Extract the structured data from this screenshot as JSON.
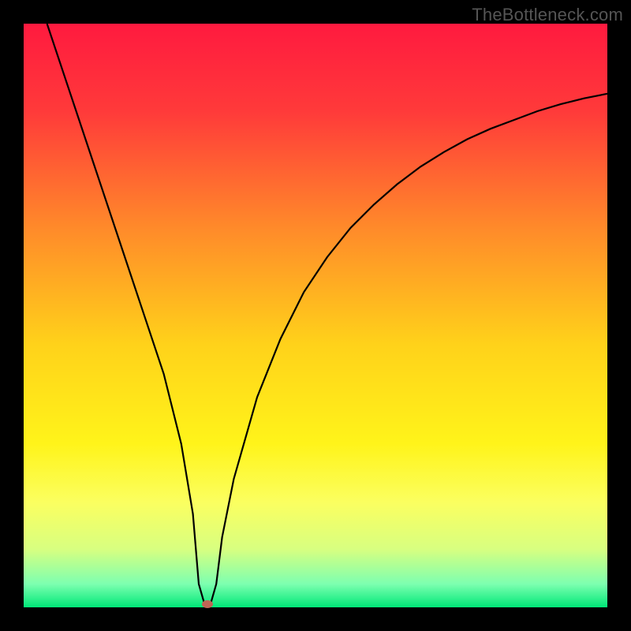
{
  "watermark": "TheBottleneck.com",
  "chart_data": {
    "type": "line",
    "title": "",
    "xlabel": "",
    "ylabel": "",
    "xlim": [
      0,
      100
    ],
    "ylim": [
      0,
      100
    ],
    "grid": false,
    "legend": false,
    "series": [
      {
        "name": "bottleneck-curve",
        "color": "#000000",
        "x": [
          4,
          8,
          12,
          16,
          20,
          24,
          27,
          29,
          30,
          31,
          32,
          33,
          34,
          36,
          40,
          44,
          48,
          52,
          56,
          60,
          64,
          68,
          72,
          76,
          80,
          84,
          88,
          92,
          96,
          100
        ],
        "y": [
          100,
          88,
          76,
          64,
          52,
          40,
          28,
          16,
          4,
          0.5,
          0.5,
          4,
          12,
          22,
          36,
          46,
          54,
          60,
          65,
          69,
          72.5,
          75.5,
          78,
          80.2,
          82,
          83.5,
          85,
          86.2,
          87.2,
          88
        ]
      }
    ],
    "marker": {
      "x": 31.5,
      "y": 0.5,
      "color": "#c06555"
    },
    "background_gradient": {
      "type": "vertical",
      "stops": [
        {
          "pos": 0.0,
          "color": "#ff1a3f"
        },
        {
          "pos": 0.15,
          "color": "#ff3a3a"
        },
        {
          "pos": 0.35,
          "color": "#ff8a2a"
        },
        {
          "pos": 0.55,
          "color": "#ffd21a"
        },
        {
          "pos": 0.72,
          "color": "#fff41a"
        },
        {
          "pos": 0.82,
          "color": "#fbff60"
        },
        {
          "pos": 0.9,
          "color": "#d8ff80"
        },
        {
          "pos": 0.96,
          "color": "#7dffb0"
        },
        {
          "pos": 1.0,
          "color": "#00e878"
        }
      ]
    }
  }
}
